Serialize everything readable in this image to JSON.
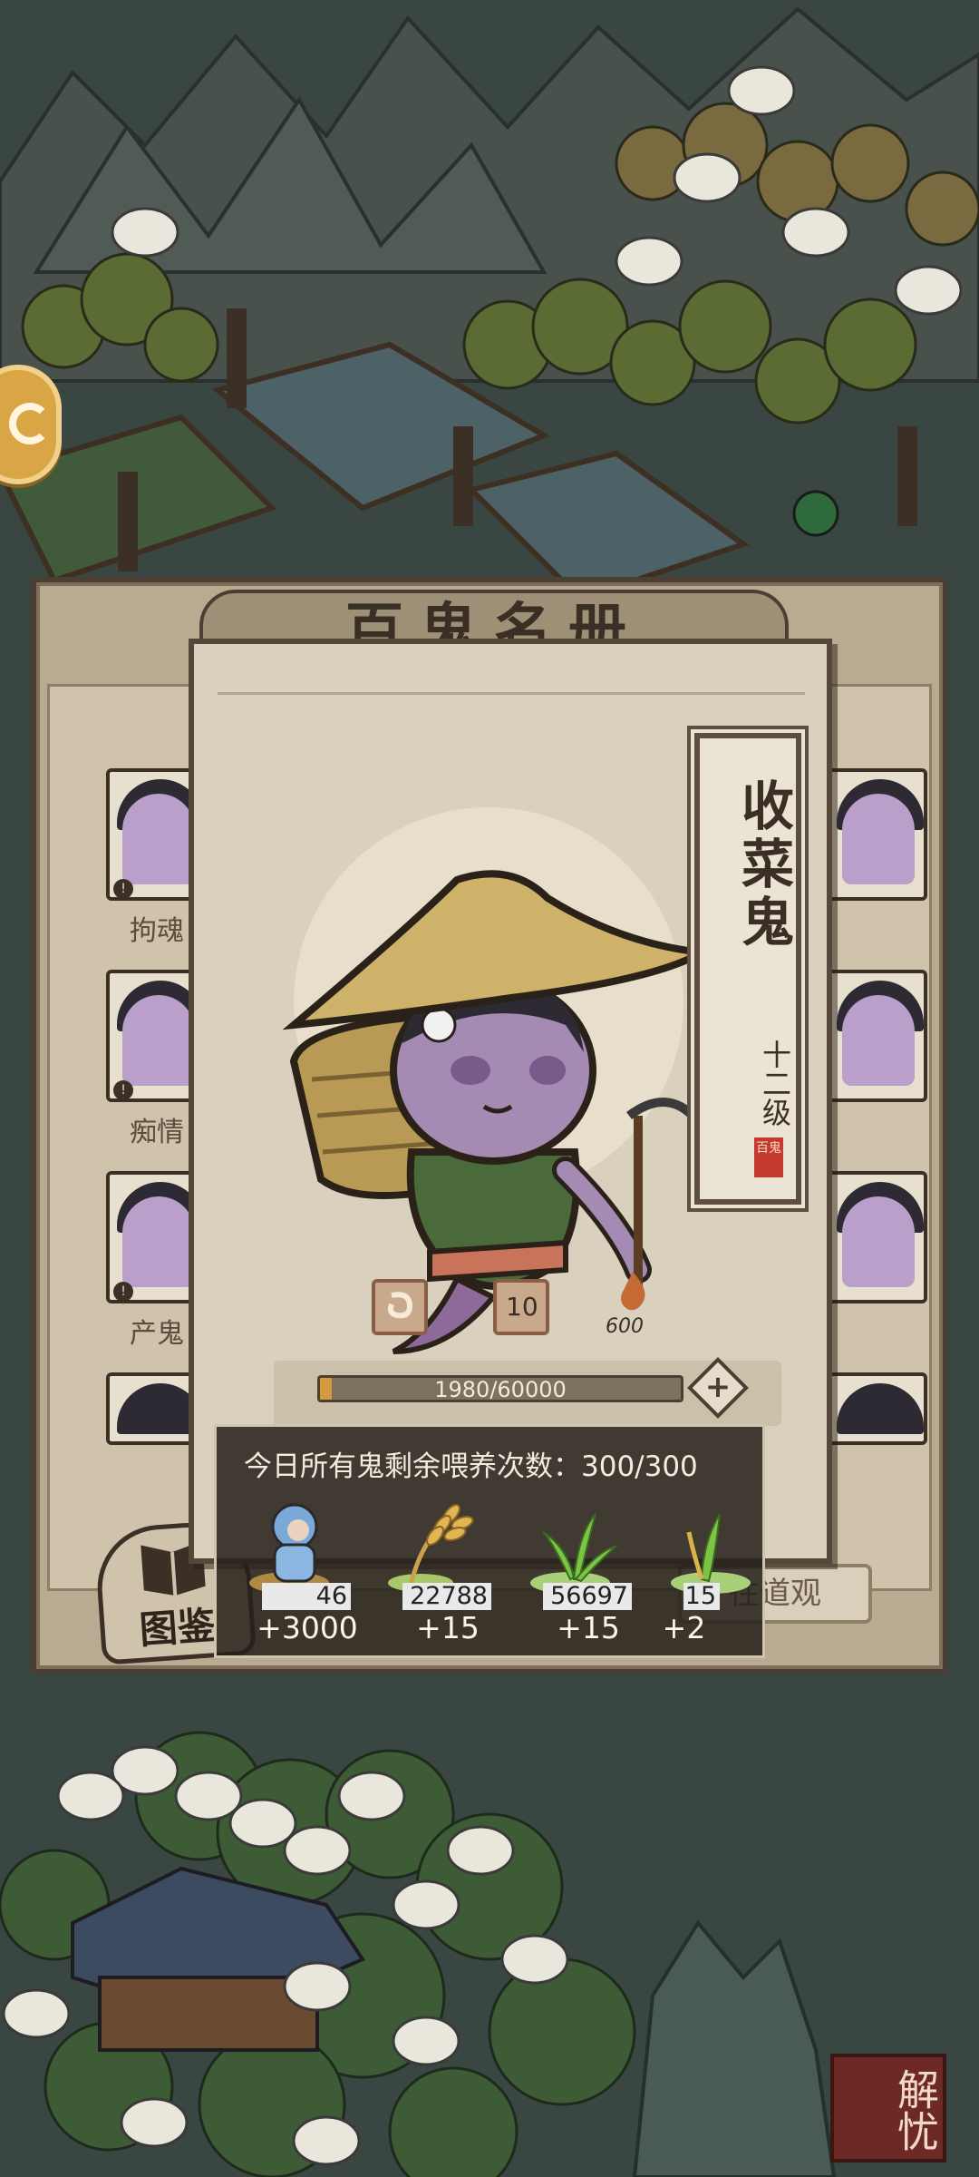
{
  "catalog": {
    "title": "百鬼名册",
    "cards": [
      {
        "label": "拘魂"
      },
      {
        "label": "痴情"
      },
      {
        "label": "产鬼"
      }
    ],
    "tab_label": "图鉴",
    "goto_label": "往道观"
  },
  "detail": {
    "name": "收菜鬼",
    "level": "十二级",
    "seal": "百鬼",
    "stats": {
      "feed_count": "10",
      "fire_value": "600"
    },
    "exp": {
      "current": 1980,
      "max": 60000,
      "text": "1980/60000"
    }
  },
  "tooltip": {
    "heading": "今日所有鬼剩余喂养次数：300/300",
    "items": [
      {
        "count": "46",
        "gain": "+3000",
        "icon": "ghost-doll-icon"
      },
      {
        "count": "22788",
        "gain": "+15",
        "icon": "wheat-icon"
      },
      {
        "count": "56697",
        "gain": "+15",
        "icon": "grass-icon"
      },
      {
        "count": "15",
        "gain": "+2",
        "icon": "sprout-icon"
      }
    ]
  },
  "stamp_text": "解忧",
  "colors": {
    "panel": "#d9d0bd",
    "frame": "#55483b",
    "exp_fill": "#d39a3f",
    "tooltip_bg": "#26211b"
  }
}
